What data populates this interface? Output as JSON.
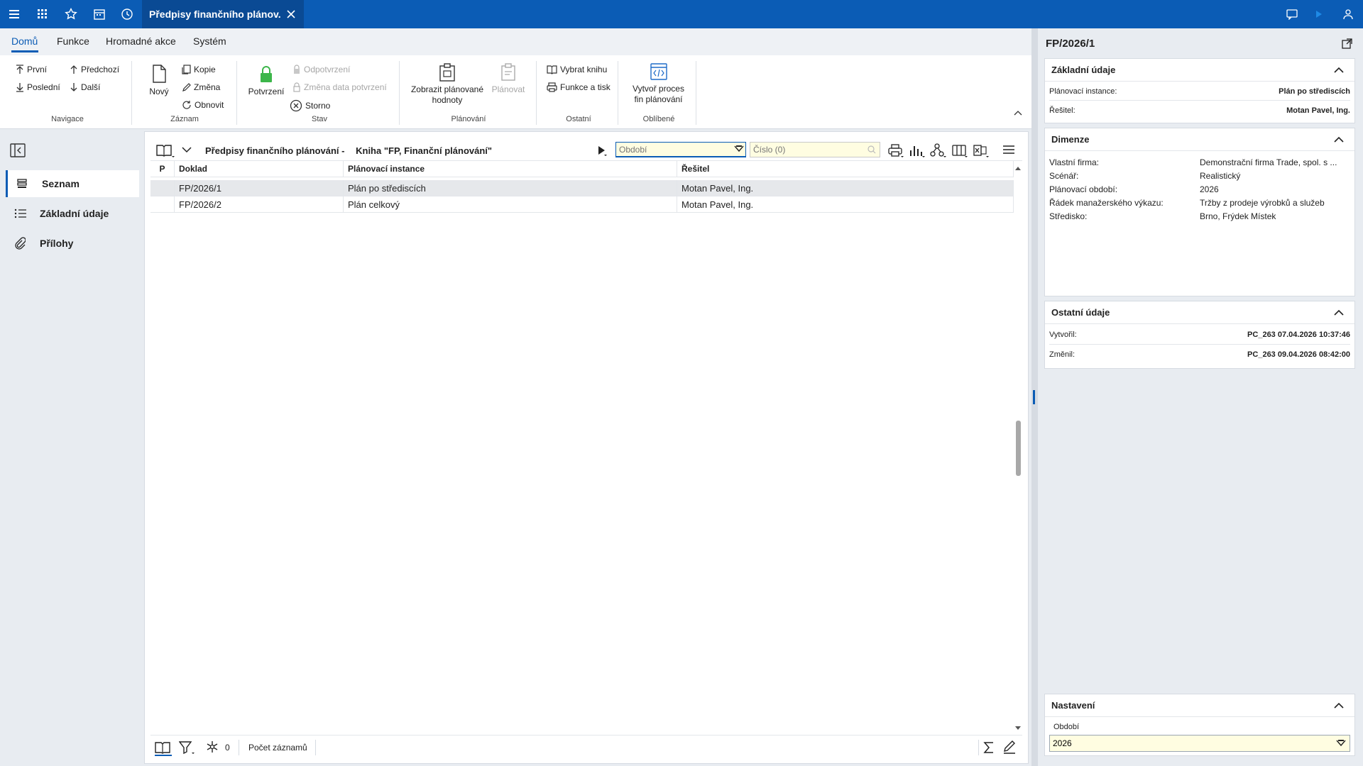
{
  "topbar": {
    "tab_title": "Předpisy finančního plánov..."
  },
  "menu": {
    "tabs": [
      "Domů",
      "Funkce",
      "Hromadné akce",
      "Systém"
    ]
  },
  "ribbon": {
    "navigace": {
      "prvni": "První",
      "predchozi": "Předchozí",
      "posledni": "Poslední",
      "dalsi": "Další",
      "label": "Navigace"
    },
    "zaznam": {
      "novy": "Nový",
      "kopie": "Kopie",
      "zmena": "Změna",
      "obnovit": "Obnovit",
      "label": "Záznam"
    },
    "stav": {
      "potvrzeni": "Potvrzení",
      "odpotvrzeni": "Odpotvrzení",
      "zmena_data": "Změna data potvrzení",
      "storno": "Storno",
      "label": "Stav"
    },
    "planovani": {
      "zobrazit_line1": "Zobrazit plánované",
      "zobrazit_line2": "hodnoty",
      "planovat": "Plánovat",
      "label": "Plánování"
    },
    "ostatni": {
      "vybrat_knihu": "Vybrat knihu",
      "funkce_tisk": "Funkce a tisk",
      "label": "Ostatní"
    },
    "oblibene": {
      "vytvor_line1": "Vytvoř proces",
      "vytvor_line2": "fin plánování",
      "label": "Oblíbené"
    }
  },
  "leftnav": {
    "items": [
      "Seznam",
      "Základní údaje",
      "Přílohy"
    ]
  },
  "list": {
    "title": "Předpisy finančního plánování -",
    "book": "Kniha \"FP, Finanční plánování\"",
    "period_placeholder": "Období",
    "number_placeholder": "Číslo (0)",
    "columns": [
      "P",
      "Doklad",
      "Plánovací instance",
      "Řešitel"
    ],
    "rows": [
      {
        "p": "",
        "doklad": "FP/2026/1",
        "instance": "Plán po střediscích",
        "resitel": "Motan Pavel, Ing."
      },
      {
        "p": "",
        "doklad": "FP/2026/2",
        "instance": "Plán celkový",
        "resitel": "Motan Pavel, Ing."
      }
    ],
    "status_count": "0",
    "status_label": "Počet záznamů"
  },
  "detail": {
    "title": "FP/2026/1",
    "zakladni": {
      "header": "Základní údaje",
      "instance_label": "Plánovací instance:",
      "instance_value": "Plán po střediscích",
      "resitel_label": "Řešitel:",
      "resitel_value": "Motan Pavel, Ing."
    },
    "dimenze": {
      "header": "Dimenze",
      "rows": [
        {
          "label": "Vlastní firma:",
          "value": "Demonstrační firma Trade, spol. s ..."
        },
        {
          "label": "Scénář:",
          "value": "Realistický"
        },
        {
          "label": "Plánovací období:",
          "value": "2026"
        },
        {
          "label": "Řádek manažerského výkazu:",
          "value": "Tržby z prodeje výrobků a služeb"
        },
        {
          "label": "Středisko:",
          "value": "Brno, Frýdek Místek"
        }
      ]
    },
    "ostatni": {
      "header": "Ostatní údaje",
      "vytvoril_label": "Vytvořil:",
      "vytvoril_value": "PC_263 07.04.2026 10:37:46",
      "zmenil_label": "Změnil:",
      "zmenil_value": "PC_263 09.04.2026 08:42:00"
    },
    "nastaveni": {
      "header": "Nastavení",
      "obdobi_label": "Období",
      "obdobi_value": "2026"
    }
  }
}
